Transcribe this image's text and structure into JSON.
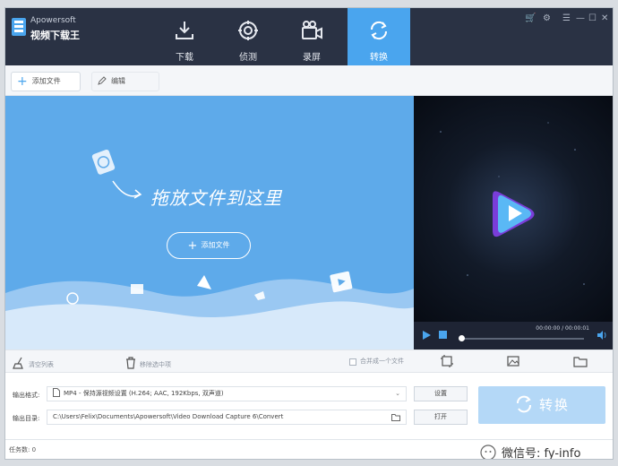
{
  "app": {
    "brand_en": "Apowersoft",
    "brand_cn": "视频下载王"
  },
  "nav": [
    {
      "label": "下载",
      "icon": "download-icon"
    },
    {
      "label": "侦测",
      "icon": "detect-icon"
    },
    {
      "label": "录屏",
      "icon": "record-icon"
    },
    {
      "label": "转换",
      "icon": "convert-icon",
      "active": true
    }
  ],
  "toolbar": {
    "add_file": "添加文件",
    "edit": "编辑"
  },
  "drop": {
    "hint": "拖放文件到这里",
    "add_file": "添加文件"
  },
  "player": {
    "time": "00:00:00 / 00:00:01",
    "progress": 0
  },
  "actions": {
    "clear_list": "清空列表",
    "remove_selected": "移除选中项",
    "merge": "合并成一个文件"
  },
  "output": {
    "format_label": "输出格式:",
    "format_value": "MP4 - 保持源视频设置 (H.264; AAC, 192Kbps, 双声道)",
    "settings_button": "设置",
    "dir_label": "输出目录:",
    "dir_value": "C:\\Users\\Felix\\Documents\\Apowersoft\\Video Download Capture 6\\Convert",
    "open_button": "打开",
    "convert_button": "转换"
  },
  "status": {
    "tasks": "任务数: 0"
  },
  "watermark": "微信号: fy-info",
  "colors": {
    "accent": "#4aa5ee",
    "titlebar": "#2a3244",
    "drop_bg": "#5eaaea",
    "convert_disabled": "#b4d8f7"
  }
}
